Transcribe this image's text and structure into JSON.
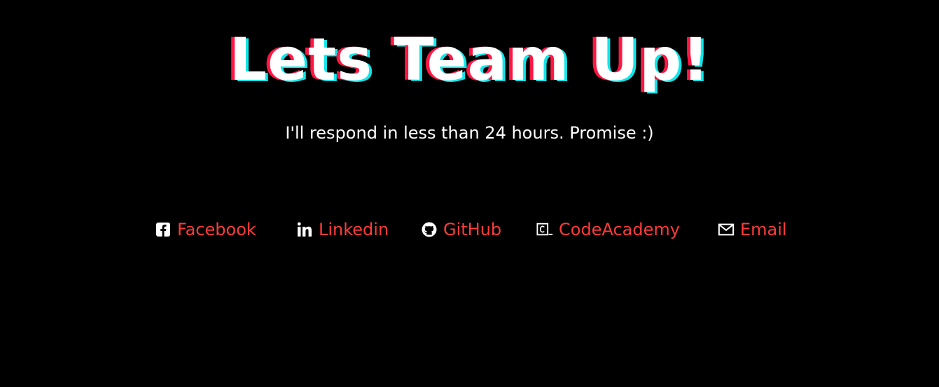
{
  "hero": {
    "title": "Lets Team Up!",
    "subtitle": "I'll respond in less than 24 hours. Promise :)"
  },
  "links": [
    {
      "label": "Facebook",
      "icon": "facebook-icon"
    },
    {
      "label": "Linkedin",
      "icon": "linkedin-icon"
    },
    {
      "label": "GitHub",
      "icon": "github-icon"
    },
    {
      "label": "CodeAcademy",
      "icon": "codeacademy-icon"
    },
    {
      "label": "Email",
      "icon": "email-icon"
    }
  ],
  "colors": {
    "background": "#000000",
    "title": "#ffffff",
    "title_shadow_red": "#ff1744",
    "title_shadow_cyan": "#10e6ea",
    "link": "#ff3b3b",
    "icon": "#ffffff"
  }
}
